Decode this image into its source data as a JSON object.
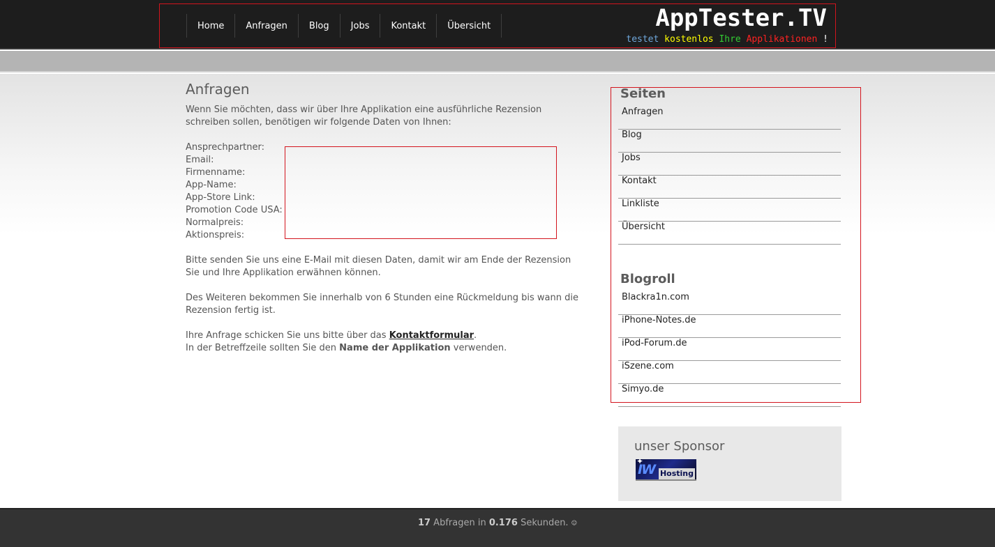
{
  "header": {
    "nav": [
      "Home",
      "Anfragen",
      "Blog",
      "Jobs",
      "Kontakt",
      "Übersicht"
    ],
    "logo": "AppTester.TV",
    "tagline": [
      {
        "text": "testet",
        "color": "#6fa8dc"
      },
      {
        "text": "kostenlos",
        "color": "#ffff00"
      },
      {
        "text": "Ihre",
        "color": "#33cc33"
      },
      {
        "text": "Applikationen",
        "color": "#ff2222"
      },
      {
        "text": "!",
        "color": "#ffffff"
      }
    ]
  },
  "main": {
    "title": "Anfragen",
    "intro": "Wenn Sie möchten, dass wir über Ihre Applikation eine ausführliche Rezension schreiben sollen, benötigen wir folgende Daten von Ihnen:",
    "fields": [
      "Ansprechpartner:",
      "Email:",
      "Firmenname:",
      "App-Name:",
      "App-Store Link:",
      "Promotion Code USA:",
      "Normalpreis:",
      "Aktionspreis:"
    ],
    "para2": "Bitte senden Sie uns eine E-Mail mit diesen Daten, damit wir am Ende der Rezension Sie und Ihre Applikation erwähnen können.",
    "para3": "Des Weiteren bekommen Sie innerhalb von 6 Stunden eine Rückmeldung bis wann die Rezension fertig ist.",
    "para4_prefix": "Ihre Anfrage schicken Sie uns bitte über das ",
    "contact_link": "Kontaktformular",
    "para4_suffix": ".",
    "para5_prefix": "In der Betreffzeile sollten Sie den ",
    "para5_bold": "Name der Applikation",
    "para5_suffix": " verwenden."
  },
  "sidebar": {
    "pages_title": "Seiten",
    "pages": [
      "Anfragen",
      "Blog",
      "Jobs",
      "Kontakt",
      "Linkliste",
      "Übersicht"
    ],
    "blogroll_title": "Blogroll",
    "blogroll": [
      "Blackra1n.com",
      "iPhone-Notes.de",
      "iPod-Forum.de",
      "iSzene.com",
      "Simyo.de"
    ]
  },
  "sponsor": {
    "title": "unser Sponsor",
    "logo_iw": "IW",
    "logo_hosting": "Hosting"
  },
  "footer": {
    "queries": "17",
    "text1": " Abfragen in ",
    "seconds": "0.176",
    "text2": " Sekunden. ",
    "smiley": "☺"
  }
}
